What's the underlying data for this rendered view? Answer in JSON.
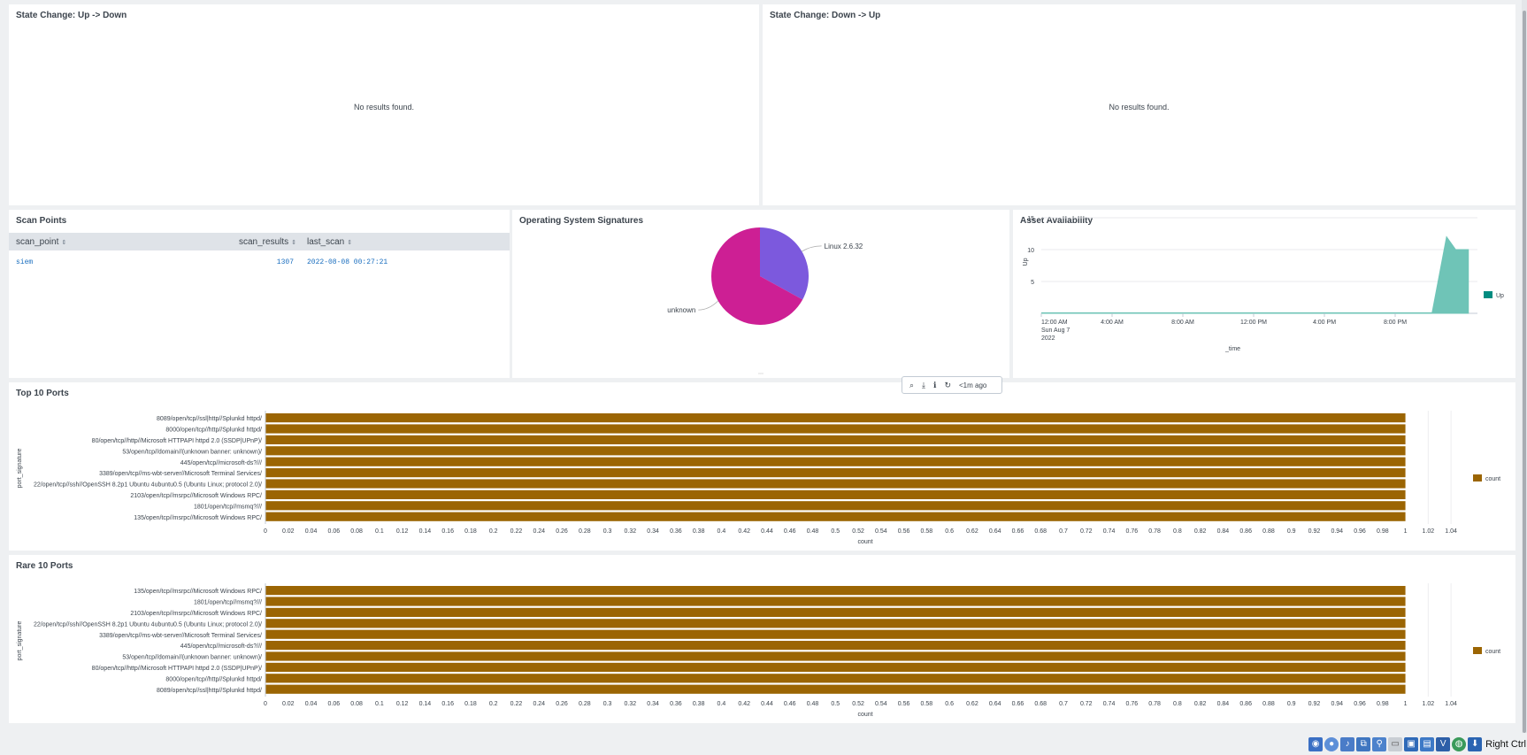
{
  "panels": {
    "up_down": {
      "title": "State Change: Up -> Down",
      "message": "No results found."
    },
    "down_up": {
      "title": "State Change: Down -> Up",
      "message": "No results found."
    },
    "scan_points": {
      "title": "Scan Points",
      "columns": [
        "scan_point",
        "scan_results",
        "last_scan"
      ],
      "rows": [
        {
          "scan_point": "siem",
          "scan_results": "1307",
          "last_scan": "2022-08-08 00:27:21"
        }
      ]
    },
    "os_signatures": {
      "title": "Operating System Signatures"
    },
    "asset_availability": {
      "title": "Asset Availability"
    },
    "top_ports": {
      "title": "Top 10 Ports"
    },
    "rare_ports": {
      "title": "Rare 10 Ports"
    }
  },
  "toolbar": {
    "search_icon": "search-icon",
    "export_icon": "download-icon",
    "inspect_icon": "info-icon",
    "refresh_icon": "refresh-icon",
    "age": "<1m ago"
  },
  "taskbar": {
    "host_key_label": "Right Ctrl"
  },
  "colors": {
    "bar": "#9b6503",
    "pie_linux": "#7c59dd",
    "pie_unknown": "#cd1f94",
    "area_up": "#6fc4b7",
    "legend_up": "#008c80"
  },
  "chart_data": [
    {
      "type": "pie",
      "title": "",
      "slices": [
        {
          "label": "Linux 2.6.32",
          "value": 33
        },
        {
          "label": "unknown",
          "value": 67
        }
      ]
    },
    {
      "type": "area",
      "title": "",
      "xlabel": "_time",
      "ylabel": "Up",
      "x_ticks": [
        {
          "line1": "12:00 AM",
          "line2": "Sun Aug 7",
          "line3": "2022"
        },
        {
          "line1": "4:00 AM"
        },
        {
          "line1": "8:00 AM"
        },
        {
          "line1": "12:00 PM"
        },
        {
          "line1": "4:00 PM"
        },
        {
          "line1": "8:00 PM"
        }
      ],
      "y_ticks": [
        5,
        10,
        15
      ],
      "ylim": [
        0,
        15
      ],
      "xlim_hours": [
        0,
        24
      ],
      "series": [
        {
          "name": "Up",
          "x_hours": [
            0,
            21.5,
            22.3,
            22.8,
            23.5,
            23.5
          ],
          "y": [
            0,
            0,
            12,
            10,
            10,
            0
          ]
        }
      ],
      "legend": "right"
    },
    {
      "type": "bar",
      "orientation": "horizontal",
      "ylabel": "port_signature",
      "xlabel": "count",
      "xlim": [
        0,
        1.05
      ],
      "x_ticks": [
        "0",
        "0.02",
        "0.04",
        "0.06",
        "0.08",
        "0.1",
        "0.12",
        "0.14",
        "0.16",
        "0.18",
        "0.2",
        "0.22",
        "0.24",
        "0.26",
        "0.28",
        "0.3",
        "0.32",
        "0.34",
        "0.36",
        "0.38",
        "0.4",
        "0.42",
        "0.44",
        "0.46",
        "0.48",
        "0.5",
        "0.52",
        "0.54",
        "0.56",
        "0.58",
        "0.6",
        "0.62",
        "0.64",
        "0.66",
        "0.68",
        "0.7",
        "0.72",
        "0.74",
        "0.76",
        "0.78",
        "0.8",
        "0.82",
        "0.84",
        "0.86",
        "0.88",
        "0.9",
        "0.92",
        "0.94",
        "0.96",
        "0.98",
        "1",
        "1.02",
        "1.04"
      ],
      "categories": [
        "8089/open/tcp//ssl|http//Splunkd httpd/",
        "8000/open/tcp//http//Splunkd httpd/",
        "80/open/tcp//http//Microsoft HTTPAPI httpd 2.0 (SSDP|UPnP)/",
        "53/open/tcp//domain//(unknown banner: unknown)/",
        "445/open/tcp//microsoft-ds?///",
        "3389/open/tcp//ms-wbt-server//Microsoft Terminal Services/",
        "22/open/tcp//ssh//OpenSSH 8.2p1 Ubuntu 4ubuntu0.5 (Ubuntu Linux; protocol 2.0)/",
        "2103/open/tcp//msrpc//Microsoft Windows RPC/",
        "1801/open/tcp//msmq?///",
        "135/open/tcp//msrpc//Microsoft Windows RPC/"
      ],
      "series": [
        {
          "name": "count",
          "values": [
            1,
            1,
            1,
            1,
            1,
            1,
            1,
            1,
            1,
            1
          ]
        }
      ],
      "legend": "right"
    },
    {
      "type": "bar",
      "orientation": "horizontal",
      "ylabel": "port_signature",
      "xlabel": "count",
      "xlim": [
        0,
        1.05
      ],
      "x_ticks": [
        "0",
        "0.02",
        "0.04",
        "0.06",
        "0.08",
        "0.1",
        "0.12",
        "0.14",
        "0.16",
        "0.18",
        "0.2",
        "0.22",
        "0.24",
        "0.26",
        "0.28",
        "0.3",
        "0.32",
        "0.34",
        "0.36",
        "0.38",
        "0.4",
        "0.42",
        "0.44",
        "0.46",
        "0.48",
        "0.5",
        "0.52",
        "0.54",
        "0.56",
        "0.58",
        "0.6",
        "0.62",
        "0.64",
        "0.66",
        "0.68",
        "0.7",
        "0.72",
        "0.74",
        "0.76",
        "0.78",
        "0.8",
        "0.82",
        "0.84",
        "0.86",
        "0.88",
        "0.9",
        "0.92",
        "0.94",
        "0.96",
        "0.98",
        "1",
        "1.02",
        "1.04"
      ],
      "categories": [
        "135/open/tcp//msrpc//Microsoft Windows RPC/",
        "1801/open/tcp//msmq?///",
        "2103/open/tcp//msrpc//Microsoft Windows RPC/",
        "22/open/tcp//ssh//OpenSSH 8.2p1 Ubuntu 4ubuntu0.5 (Ubuntu Linux; protocol 2.0)/",
        "3389/open/tcp//ms-wbt-server//Microsoft Terminal Services/",
        "445/open/tcp//microsoft-ds?///",
        "53/open/tcp//domain//(unknown banner: unknown)/",
        "80/open/tcp//http//Microsoft HTTPAPI httpd 2.0 (SSDP|UPnP)/",
        "8000/open/tcp//http//Splunkd httpd/",
        "8089/open/tcp//ssl|http//Splunkd httpd/"
      ],
      "series": [
        {
          "name": "count",
          "values": [
            1,
            1,
            1,
            1,
            1,
            1,
            1,
            1,
            1,
            1
          ]
        }
      ],
      "legend": "right"
    }
  ]
}
